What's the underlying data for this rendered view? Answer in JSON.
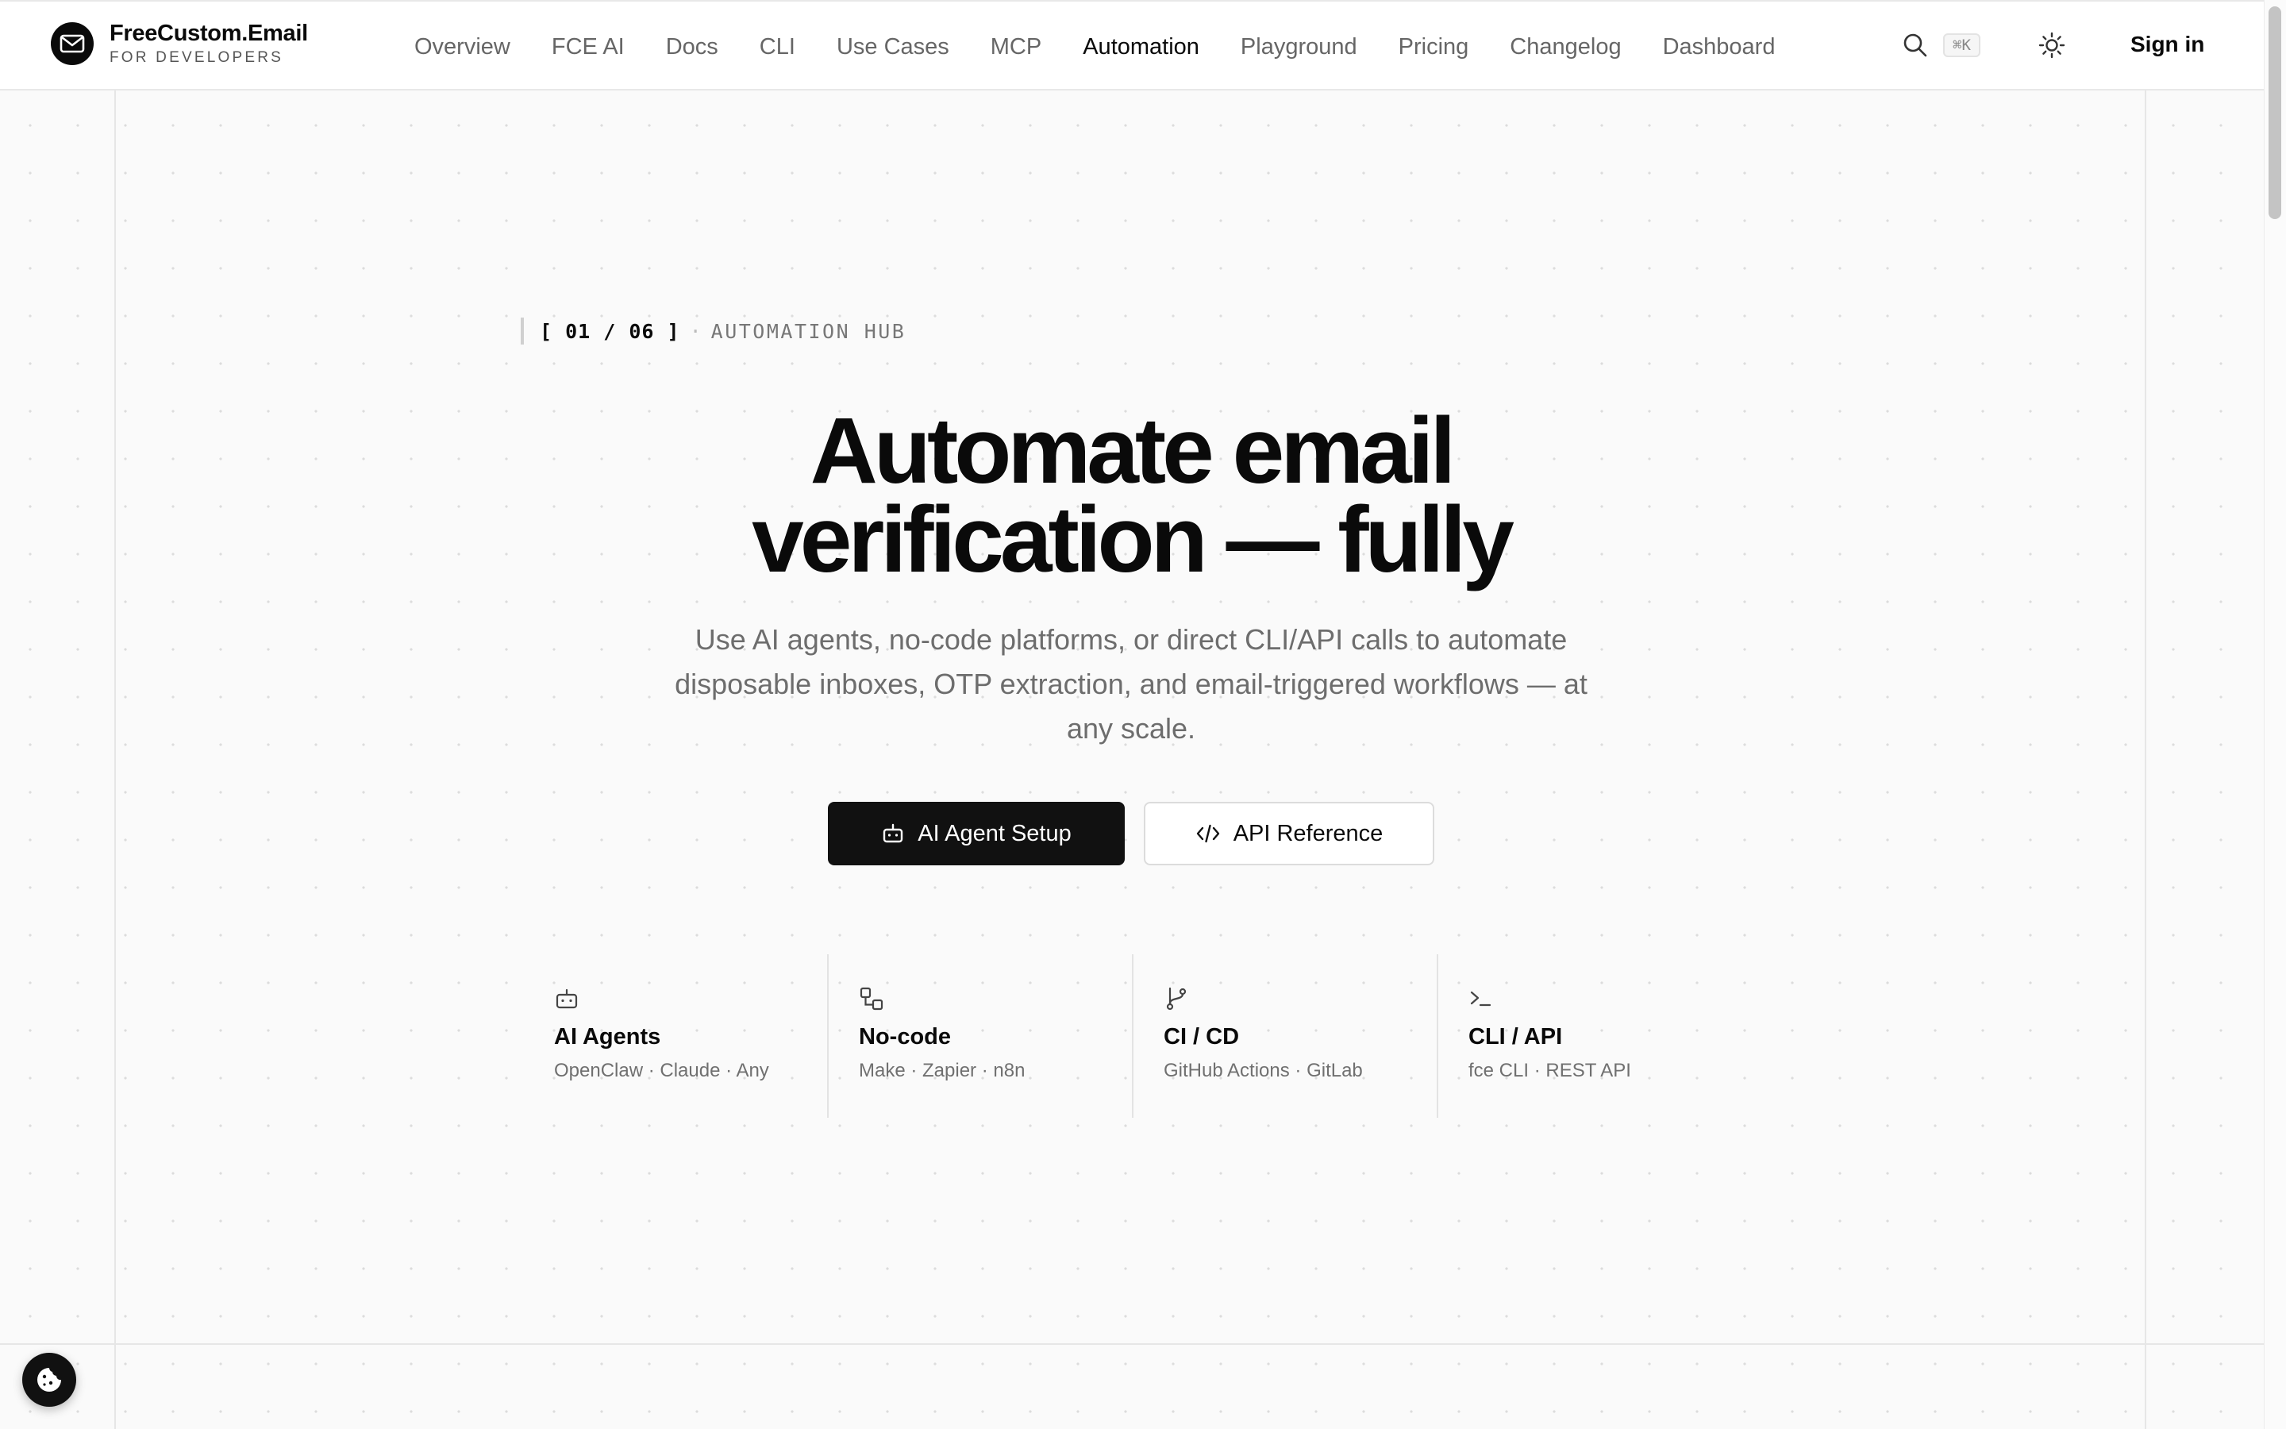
{
  "brand": {
    "name": "FreeCustom.Email",
    "tagline": "FOR DEVELOPERS"
  },
  "nav": {
    "items": [
      "Overview",
      "FCE AI",
      "Docs",
      "CLI",
      "Use Cases",
      "MCP",
      "Automation",
      "Playground",
      "Pricing",
      "Changelog",
      "Dashboard"
    ],
    "active": "Automation"
  },
  "header": {
    "search_shortcut": "⌘K",
    "signin_label": "Sign in"
  },
  "hero": {
    "counter": "[ 01 / 06 ]",
    "separator": "·",
    "section_label": "AUTOMATION HUB",
    "headline_line1": "Automate email",
    "headline_line2": "verification — fully",
    "subhead": "Use AI agents, no-code platforms, or direct CLI/API calls to automate disposable inboxes, OTP extraction, and email-triggered workflows — at any scale.",
    "primary_cta": "AI Agent Setup",
    "secondary_cta": "API Reference"
  },
  "features": [
    {
      "icon": "bot-icon",
      "title": "AI Agents",
      "subtitle": "OpenClaw · Claude · Any"
    },
    {
      "icon": "workflow-icon",
      "title": "No-code",
      "subtitle": "Make · Zapier · n8n"
    },
    {
      "icon": "git-branch-icon",
      "title": "CI / CD",
      "subtitle": "GitHub Actions · GitLab"
    },
    {
      "icon": "terminal-icon",
      "title": "CLI / API",
      "subtitle": "fce CLI · REST API"
    }
  ],
  "colors": {
    "background": "#fafafa",
    "text": "#0a0a0a",
    "muted": "#6d6d6d",
    "primary_button": "#111111"
  }
}
